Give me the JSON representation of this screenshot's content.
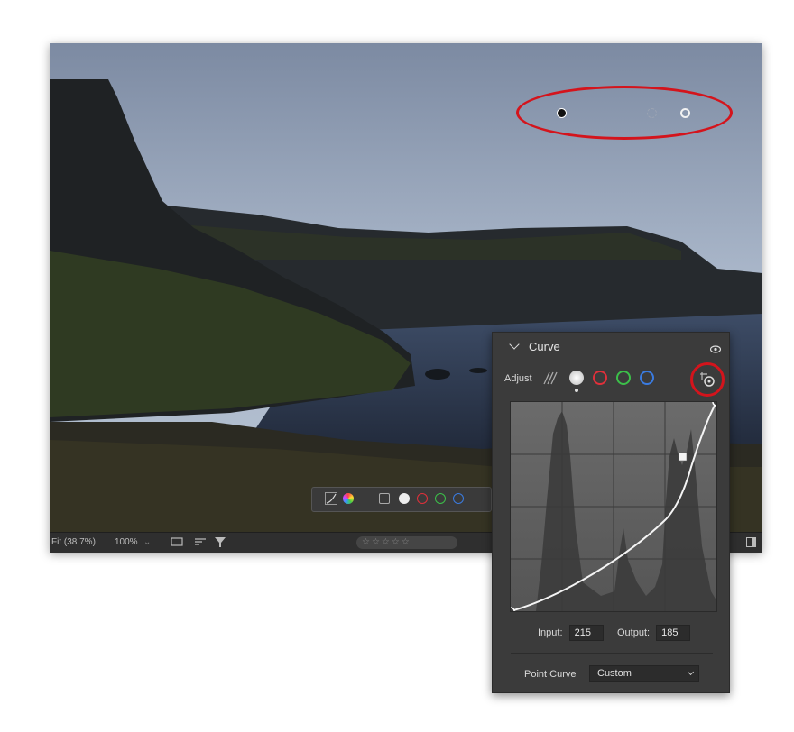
{
  "bottom_bar": {
    "fit_label": "Fit (38.7%)",
    "zoom_label": "100%",
    "rating_stars": "☆☆☆☆☆"
  },
  "curve_panel": {
    "title": "Curve",
    "adjust_label": "Adjust",
    "input_label": "Input:",
    "input_value": "215",
    "output_label": "Output:",
    "output_value": "185",
    "point_curve_label": "Point Curve",
    "point_curve_value": "Custom"
  },
  "colors": {
    "annotation_red": "#d4141c",
    "channel_red": "#e0303a",
    "channel_green": "#3cbf4a",
    "channel_blue": "#3a7be0"
  },
  "icons": [
    "curve-icon",
    "color-wheel-icon",
    "parametric-icon",
    "rgb-channel-icon",
    "eye-icon",
    "targeted-adjustment-icon",
    "filter-icon",
    "sort-icon",
    "view-icon",
    "chevron-down-icon"
  ]
}
